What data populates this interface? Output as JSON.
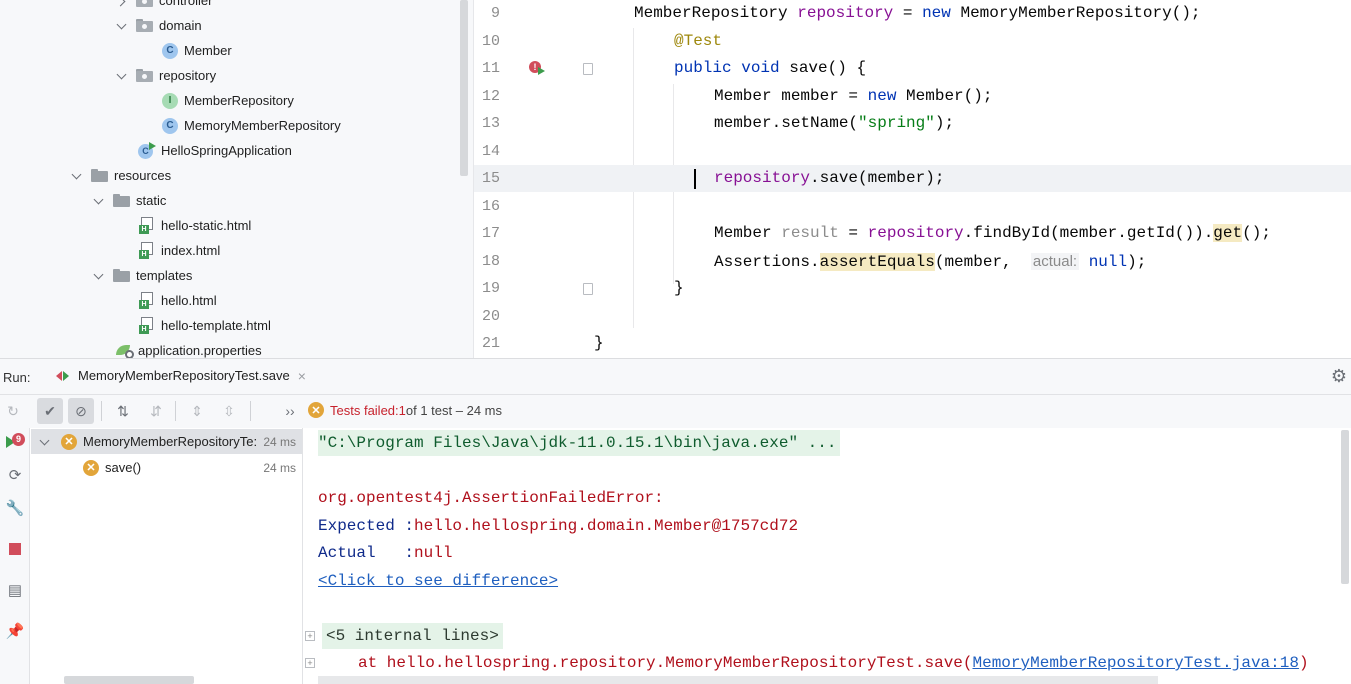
{
  "project_tree": {
    "items": [
      {
        "label": "controller",
        "kind": "package"
      },
      {
        "label": "domain",
        "kind": "package"
      },
      {
        "label": "Member",
        "kind": "class",
        "icon_letter": "C"
      },
      {
        "label": "repository",
        "kind": "package"
      },
      {
        "label": "MemberRepository",
        "kind": "interface",
        "icon_letter": "I"
      },
      {
        "label": "MemoryMemberRepository",
        "kind": "class",
        "icon_letter": "C"
      },
      {
        "label": "HelloSpringApplication",
        "kind": "app",
        "icon_letter": "C"
      },
      {
        "label": "resources",
        "kind": "folder"
      },
      {
        "label": "static",
        "kind": "folder"
      },
      {
        "label": "hello-static.html",
        "kind": "html",
        "icon_letter": "H"
      },
      {
        "label": "index.html",
        "kind": "html",
        "icon_letter": "H"
      },
      {
        "label": "templates",
        "kind": "folder"
      },
      {
        "label": "hello.html",
        "kind": "html",
        "icon_letter": "H"
      },
      {
        "label": "hello-template.html",
        "kind": "html",
        "icon_letter": "H"
      },
      {
        "label": "application.properties",
        "kind": "properties"
      }
    ]
  },
  "editor": {
    "line_numbers": [
      "9",
      "10",
      "11",
      "12",
      "13",
      "14",
      "15",
      "16",
      "17",
      "18",
      "19",
      "20",
      "21"
    ],
    "line9": {
      "type": "MemberRepository ",
      "field": "repository",
      "eq": " = ",
      "kw_new": "new",
      "rest": " MemoryMemberRepository();"
    },
    "line10": {
      "annotation": "@Test"
    },
    "line11": {
      "kw_public": "public",
      "kw_void": " void",
      "rest": " save() {"
    },
    "line12": {
      "pre": "Member member = ",
      "kw_new": "new",
      "rest": " Member();"
    },
    "line13": {
      "pre": "member.setName(",
      "string": "\"spring\"",
      "rest": ");"
    },
    "line15": {
      "field": "repository",
      "rest": ".save(member);"
    },
    "line17": {
      "type": "Member ",
      "var": "result",
      "eq": " = ",
      "field": "repository",
      "mid": ".findById(member.getId()).",
      "hl": "get",
      "rest": "();"
    },
    "line18": {
      "pre": "Assertions.",
      "hl": "assertEquals",
      "mid": "(member, ",
      "hint": "actual:",
      "kw_null": "null",
      "rest": ");"
    },
    "line19": {
      "brace": "}"
    },
    "line21": {
      "brace": "}"
    },
    "error_badge": "!"
  },
  "run_panel": {
    "label": "Run:",
    "tab_title": "MemoryMemberRepositoryTest.save",
    "tab_close": "×",
    "settings_icon": "⚙",
    "toolbar": {
      "more_label": "››",
      "status_prefix": "Tests failed: ",
      "status_failed_count": "1",
      "status_suffix": " of 1 test – 24 ms"
    },
    "badge_count": "9",
    "test_tree": [
      {
        "label": "MemoryMemberRepositoryTe:",
        "time": "24 ms"
      },
      {
        "label": "save()",
        "time": "24 ms"
      }
    ],
    "console": {
      "cmd": "\"C:\\Program Files\\Java\\jdk-11.0.15.1\\bin\\java.exe\" ...",
      "error": "org.opentest4j.AssertionFailedError:",
      "expected_key": "Expected :",
      "expected_val": "hello.hellospring.domain.Member@1757cd72",
      "actual_key": "Actual   :",
      "actual_val": "null",
      "diff_link": "<Click to see difference>",
      "internal": "<5 internal lines>",
      "at_prefix": "at hello.hellospring.repository.MemoryMemberRepositoryTest.save(",
      "at_link": "MemoryMemberRepositoryTest.java:18",
      "at_suffix": ")"
    }
  }
}
